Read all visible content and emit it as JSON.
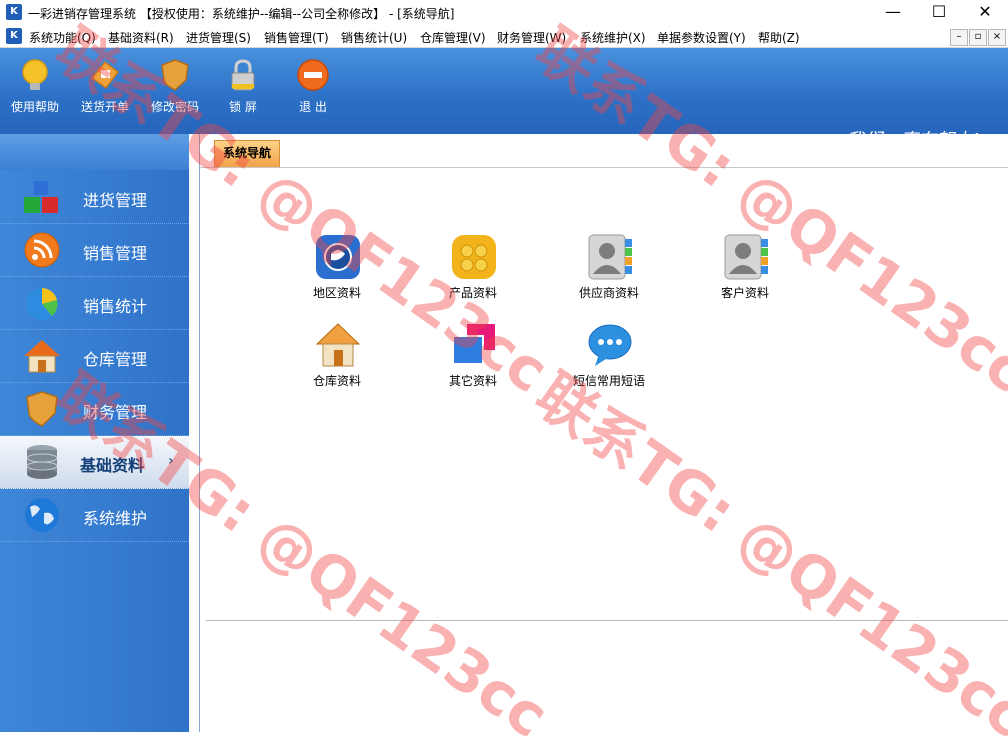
{
  "window": {
    "app_icon": "K",
    "title": "一彩进销存管理系统  【授权使用：系统维护--编辑--公司全称修改】 - [系统导航]",
    "controls": [
      "—",
      "☐",
      "✕"
    ]
  },
  "menu": {
    "icon": "K",
    "items": [
      "系统功能(Q)",
      "基础资料(R)",
      "进货管理(S)",
      "销售管理(T)",
      "销售统计(U)",
      "仓库管理(V)",
      "财务管理(W)",
      "系统维护(X)",
      "单据参数设置(Y)",
      "帮助(Z)"
    ],
    "mdi_controls": [
      "–",
      "▫",
      "×"
    ]
  },
  "toolbar": {
    "buttons": [
      {
        "label": "使用帮助",
        "icon": "bulb-icon",
        "color": "#f6c22a"
      },
      {
        "label": "送货开单",
        "icon": "delivery-icon",
        "color": "#f0a23a"
      },
      {
        "label": "修改密码",
        "icon": "shield-icon",
        "color": "#e7a13a"
      },
      {
        "label": "锁    屏",
        "icon": "lock-icon",
        "color": "#c9c9c9"
      },
      {
        "label": "退    出",
        "icon": "exit-icon",
        "color": "#ef6a1d"
      }
    ],
    "slogan": "我们一直在努力!"
  },
  "sidebar": {
    "items": [
      {
        "label": "进货管理",
        "icon": "blocks-icon",
        "active": false
      },
      {
        "label": "销售管理",
        "icon": "rss-icon",
        "active": false
      },
      {
        "label": "销售统计",
        "icon": "pie-chart-icon",
        "active": false
      },
      {
        "label": "仓库管理",
        "icon": "house-icon",
        "active": false
      },
      {
        "label": "财务管理",
        "icon": "shield-icon",
        "active": false
      },
      {
        "label": "基础资料",
        "icon": "database-icon",
        "active": true
      },
      {
        "label": "系统维护",
        "icon": "globe-icon",
        "active": false
      }
    ],
    "active_arrow": "›"
  },
  "content": {
    "tab_label": "系统导航",
    "tiles": [
      {
        "label": "地区资料",
        "icon": "region-icon",
        "color": "#2a6fd0"
      },
      {
        "label": "产品资料",
        "icon": "product-icon",
        "color": "#f2b41a"
      },
      {
        "label": "供应商资料",
        "icon": "contact-icon",
        "color": "#9a9a9a"
      },
      {
        "label": "客户资料",
        "icon": "contact-icon",
        "color": "#9a9a9a"
      },
      {
        "label": "仓库资料",
        "icon": "warehouse-icon",
        "color": "#f0a040"
      },
      {
        "label": "其它资料",
        "icon": "other-icon",
        "color": "#e6187a"
      },
      {
        "label": "短信常用短语",
        "icon": "chat-icon",
        "color": "#2c8fe0"
      }
    ]
  },
  "watermark": {
    "text": "联系TG: @QF123cc"
  }
}
